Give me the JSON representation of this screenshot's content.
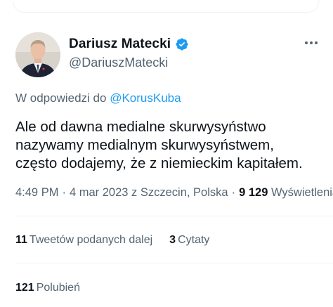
{
  "tweet": {
    "author": {
      "name": "Dariusz Matecki",
      "handle": "@DariuszMatecki",
      "verified": true,
      "avatar_icon": "profile-photo",
      "verified_color": "#1d9bf0"
    },
    "reply": {
      "prefix": "W odpowiedzi do",
      "mention": "@KorusKuba"
    },
    "text": "Ale od dawna medialne skurwysyństwo\nnazywamy medialnym skurwysyństwem,\nczęsto dodajemy, że z niemieckim kapitałem.",
    "meta": {
      "time": "4:49 PM",
      "date": "4 mar 2023",
      "location": "z Szczecin, Polska",
      "views_count": "9 129",
      "views_label": "Wyświetlenia"
    },
    "stats": {
      "retweets_count": "11",
      "retweets_label": "Tweetów podanych dalej",
      "quotes_count": "3",
      "quotes_label": "Cytaty",
      "likes_count": "121",
      "likes_label": "Polubień"
    },
    "more_icon": "more-horizontal"
  },
  "colors": {
    "text_primary": "#0f1419",
    "text_secondary": "#536471",
    "link": "#1d9bf0",
    "divider": "#eff3f4"
  }
}
